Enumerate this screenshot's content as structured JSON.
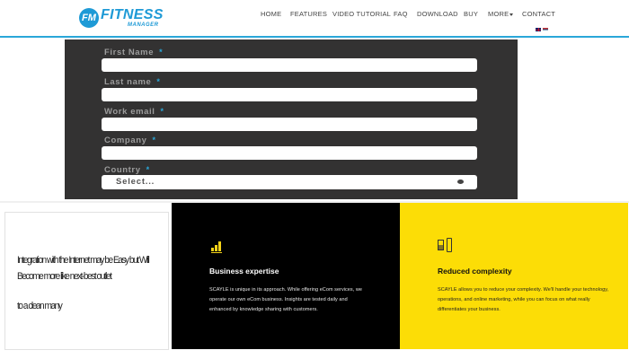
{
  "header": {
    "logo_badge": "FM",
    "logo_main": "FITNESS",
    "logo_sub": "MANAGER",
    "nav": {
      "home": "HOME",
      "features": "FEATURES",
      "video": "VIDEO TUTORIAL",
      "faq": "FAQ",
      "download": "DOWNLOAD",
      "buy": "BUY",
      "more": "MORE",
      "contact": "CONTACT"
    }
  },
  "form": {
    "first_name": "First Name",
    "last_name": "Last name",
    "work_email": "Work email",
    "company": "Company",
    "country": "Country",
    "required_mark": "*",
    "country_select": "Select..."
  },
  "video_card": {
    "text_line1": "Integration with the Internet may be Easy but Will Become more like next-best outlet",
    "text_line2": "to a clean many"
  },
  "features": {
    "business": {
      "title": "Business expertise",
      "body": "SCAYLE is unique in its approach. While offering eCom services, we operate our own eCom business. Insights are tested daily and enhanced by knowledge sharing with customers."
    },
    "complexity": {
      "title": "Reduced complexity",
      "body": "SCAYLE allows you to reduce your complexity. We'll handle your technology, operations, and online marketing, while you can focus on what really differentiates your business."
    }
  },
  "colors": {
    "brand": "#1e9ad6",
    "accent_line": "#2aa7d9",
    "form_bg": "#333232",
    "yellow": "#fcdd06",
    "icon_yellow": "#f6d318"
  }
}
